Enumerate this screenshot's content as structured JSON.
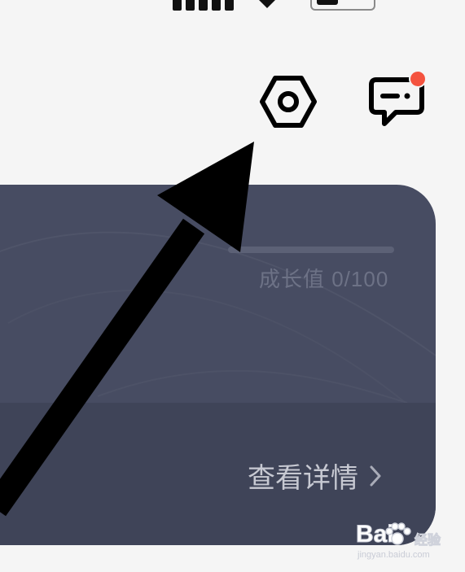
{
  "status_bar": {
    "signal_icon": "signal-bars-icon",
    "wifi_icon": "wifi-icon",
    "battery_icon": "battery-icon"
  },
  "header": {
    "settings_icon": "hexagon-settings-icon",
    "messages_icon": "chat-bubble-icon",
    "messages_badge_color": "#f4533f"
  },
  "member_card": {
    "growth": {
      "label": "成长值 0/100",
      "current": 0,
      "max": 100,
      "fill_fraction": 0.0
    },
    "details_link": {
      "label": "查看详情",
      "icon": "chevron-right-icon"
    },
    "colors": {
      "card": "#474c62",
      "card_lower": "#3f4458",
      "label": "#6d7286",
      "link": "#c7c9d2"
    }
  },
  "annotation": {
    "arrow_icon": "pointer-arrow-icon",
    "color": "#000000"
  },
  "watermark": {
    "logo": "Bai",
    "logo_suffix": "经验",
    "site": "jingyan.baidu.com"
  }
}
